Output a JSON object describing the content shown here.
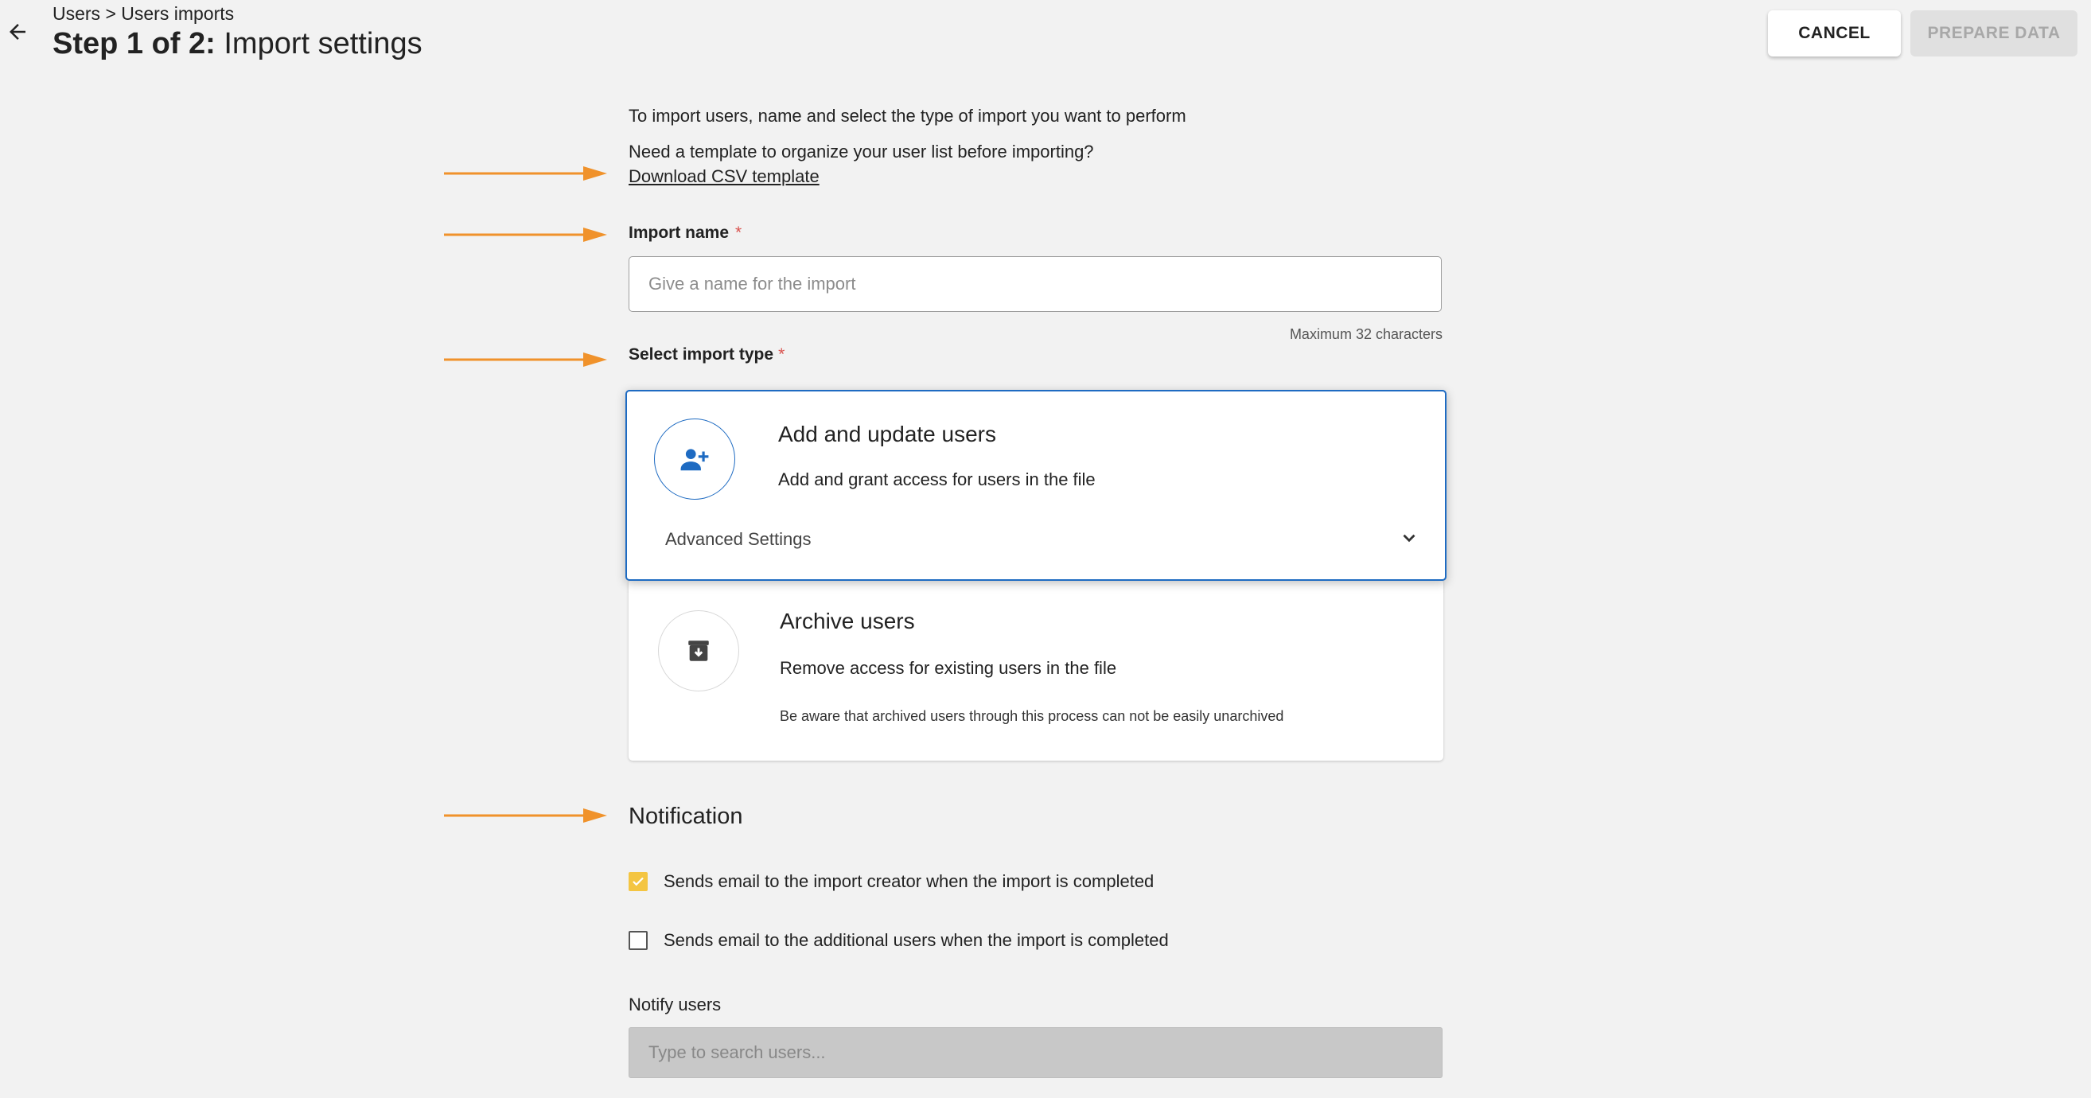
{
  "header": {
    "breadcrumb": "Users > Users imports",
    "title_step": "Step 1 of 2:",
    "title_text": " Import settings",
    "cancel_label": "CANCEL",
    "prepare_label": "PREPARE DATA"
  },
  "intro": {
    "text": "To import users, name and select the type of import you want to perform",
    "template_question": "Need a template to organize your user list before importing?",
    "template_link": "Download CSV template"
  },
  "import_name": {
    "label": "Import name",
    "required_mark": "*",
    "placeholder": "Give a name for the import",
    "value": "",
    "hint": "Maximum 32 characters"
  },
  "import_type": {
    "label": "Select import type",
    "required_mark": "*",
    "options": [
      {
        "title": "Add and update users",
        "description": "Add and grant access for users in the file",
        "advanced_label": "Advanced Settings",
        "selected": true,
        "icon": "person-add-icon"
      },
      {
        "title": "Archive users",
        "description": "Remove access for existing users in the file",
        "warning": "Be aware that archived users through this process can not be easily unarchived",
        "selected": false,
        "icon": "archive-icon"
      }
    ]
  },
  "notification": {
    "title": "Notification",
    "options": [
      {
        "label": "Sends email to the import creator when the import is completed",
        "checked": true
      },
      {
        "label": "Sends email to the additional users when the import is completed",
        "checked": false
      }
    ],
    "notify_label": "Notify users",
    "notify_placeholder": "Type to search users..."
  },
  "colors": {
    "accent": "#1e6bc2",
    "arrow": "#f0922b",
    "checkbox": "#f4c542",
    "required": "#d9534f"
  }
}
